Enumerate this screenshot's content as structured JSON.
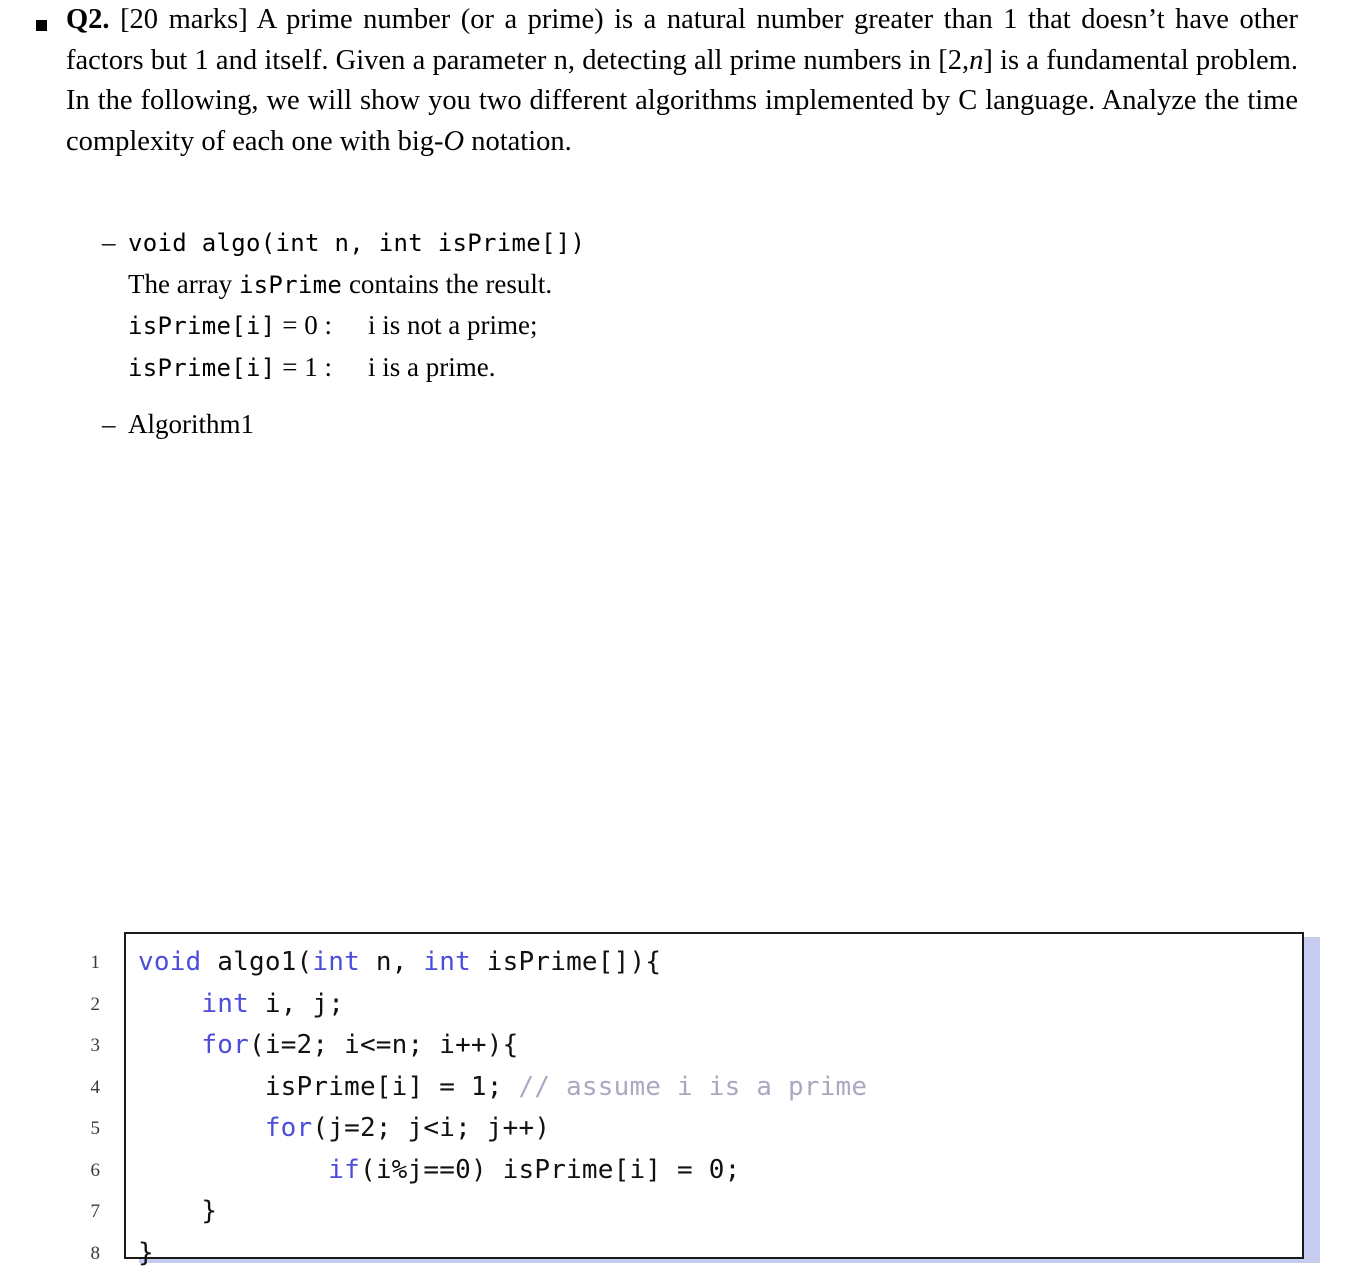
{
  "question": {
    "bullet": "square-bullet",
    "label": "Q2.",
    "marks": "[20 marks]",
    "text_part1": " A prime number (or a prime) is a natural number greater than 1 that doesn’t have other factors but 1 and itself. Given a parameter n, detecting all prime numbers in [2,",
    "math_n": "n",
    "text_part2": "] is a fundamental problem. In the following, we will show you two different algorithms implemented by C language. Analyze the time complexity of each one with big-",
    "math_O": "O",
    "text_part3": " notation."
  },
  "sub_items": [
    {
      "dash": "–",
      "lines": [
        {
          "type": "mono",
          "text": "void algo(int n, int isPrime[])"
        },
        {
          "type": "mixed",
          "pre": "The array ",
          "mono": "isPrime",
          "post": " contains the result."
        },
        {
          "type": "def",
          "mono": "isPrime[i]",
          "eq": " = 0 :",
          "desc": "i is not a prime;"
        },
        {
          "type": "def",
          "mono": "isPrime[i]",
          "eq": " = 1 :",
          "desc": "i is a prime."
        }
      ]
    },
    {
      "dash": "–",
      "lines": [
        {
          "type": "plain",
          "text": "Algorithm1"
        }
      ]
    }
  ],
  "listing": {
    "language": "C",
    "border_color": "#1a1a1a",
    "shadow_color": "#c6ccee",
    "keyword_color": "#4d4ddb",
    "comment_color": "#a9a9c2",
    "text_color": "#111111",
    "lines": [
      {
        "number": "1",
        "tokens": [
          {
            "t": "void",
            "c": "kw"
          },
          {
            "t": " algo1(",
            "c": "txt"
          },
          {
            "t": "int",
            "c": "kw"
          },
          {
            "t": " n, ",
            "c": "txt"
          },
          {
            "t": "int",
            "c": "kw"
          },
          {
            "t": " isPrime[]){",
            "c": "txt"
          }
        ]
      },
      {
        "number": "2",
        "tokens": [
          {
            "t": "    ",
            "c": "txt"
          },
          {
            "t": "int",
            "c": "kw"
          },
          {
            "t": " i, j;",
            "c": "txt"
          }
        ]
      },
      {
        "number": "3",
        "tokens": [
          {
            "t": "    ",
            "c": "txt"
          },
          {
            "t": "for",
            "c": "kw"
          },
          {
            "t": "(i=2; i<=n; i++){",
            "c": "txt"
          }
        ]
      },
      {
        "number": "4",
        "tokens": [
          {
            "t": "        isPrime[i] = 1; ",
            "c": "txt"
          },
          {
            "t": "// assume i is a prime",
            "c": "cmt"
          }
        ]
      },
      {
        "number": "5",
        "tokens": [
          {
            "t": "        ",
            "c": "txt"
          },
          {
            "t": "for",
            "c": "kw"
          },
          {
            "t": "(j=2; j<i; j++)",
            "c": "txt"
          }
        ]
      },
      {
        "number": "6",
        "tokens": [
          {
            "t": "            ",
            "c": "txt"
          },
          {
            "t": "if",
            "c": "kw"
          },
          {
            "t": "(i%j==0) isPrime[i] = 0;",
            "c": "txt"
          }
        ]
      },
      {
        "number": "7",
        "tokens": [
          {
            "t": "    }",
            "c": "txt"
          }
        ]
      },
      {
        "number": "8",
        "tokens": [
          {
            "t": "}",
            "c": "txt"
          }
        ]
      }
    ]
  }
}
